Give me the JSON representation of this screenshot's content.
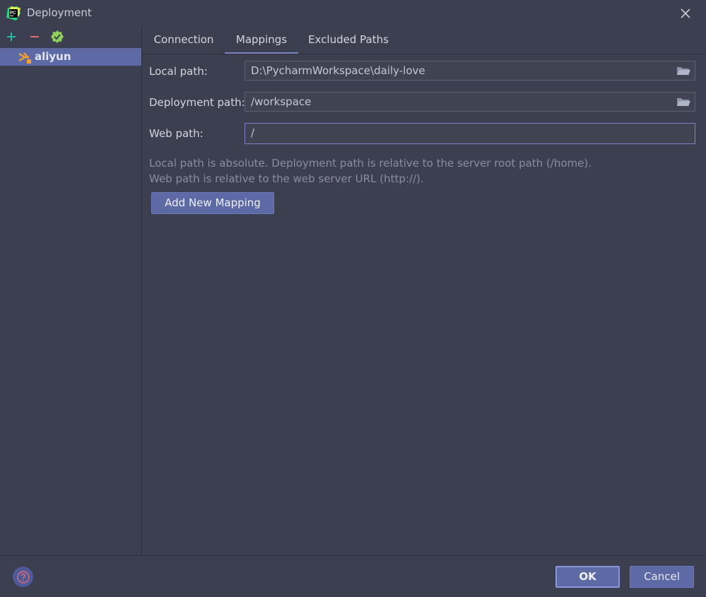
{
  "window": {
    "title": "Deployment",
    "app_icon": "pycharm-icon",
    "app_icon_text": "PC"
  },
  "toolbar": {
    "add_icon": "plus-icon",
    "remove_icon": "minus-icon",
    "default_icon": "check-badge-icon"
  },
  "servers": [
    {
      "label": "aliyun",
      "icon": "sftp-server-icon",
      "selected": true
    }
  ],
  "tabs": [
    {
      "label": "Connection",
      "active": false
    },
    {
      "label": "Mappings",
      "active": true
    },
    {
      "label": "Excluded Paths",
      "active": false
    }
  ],
  "form": {
    "local_path_label": "Local path:",
    "local_path_value": "D:\\PycharmWorkspace\\daily-love",
    "deployment_path_label": "Deployment path:",
    "deployment_path_value": "/workspace",
    "web_path_label": "Web path:",
    "web_path_value": "/",
    "hint_line1": "Local path is absolute. Deployment path is relative to the server root path (/home).",
    "hint_line2": "Web path is relative to the web server URL (http://).",
    "add_mapping_label": "Add New Mapping"
  },
  "footer": {
    "help_icon": "help-icon",
    "ok_label": "OK",
    "cancel_label": "Cancel"
  },
  "colors": {
    "background": "#3c3f4f",
    "accent": "#5d6aa5",
    "add": "#29b6a4",
    "remove": "#e06c75",
    "check": "#8fcf5b"
  }
}
